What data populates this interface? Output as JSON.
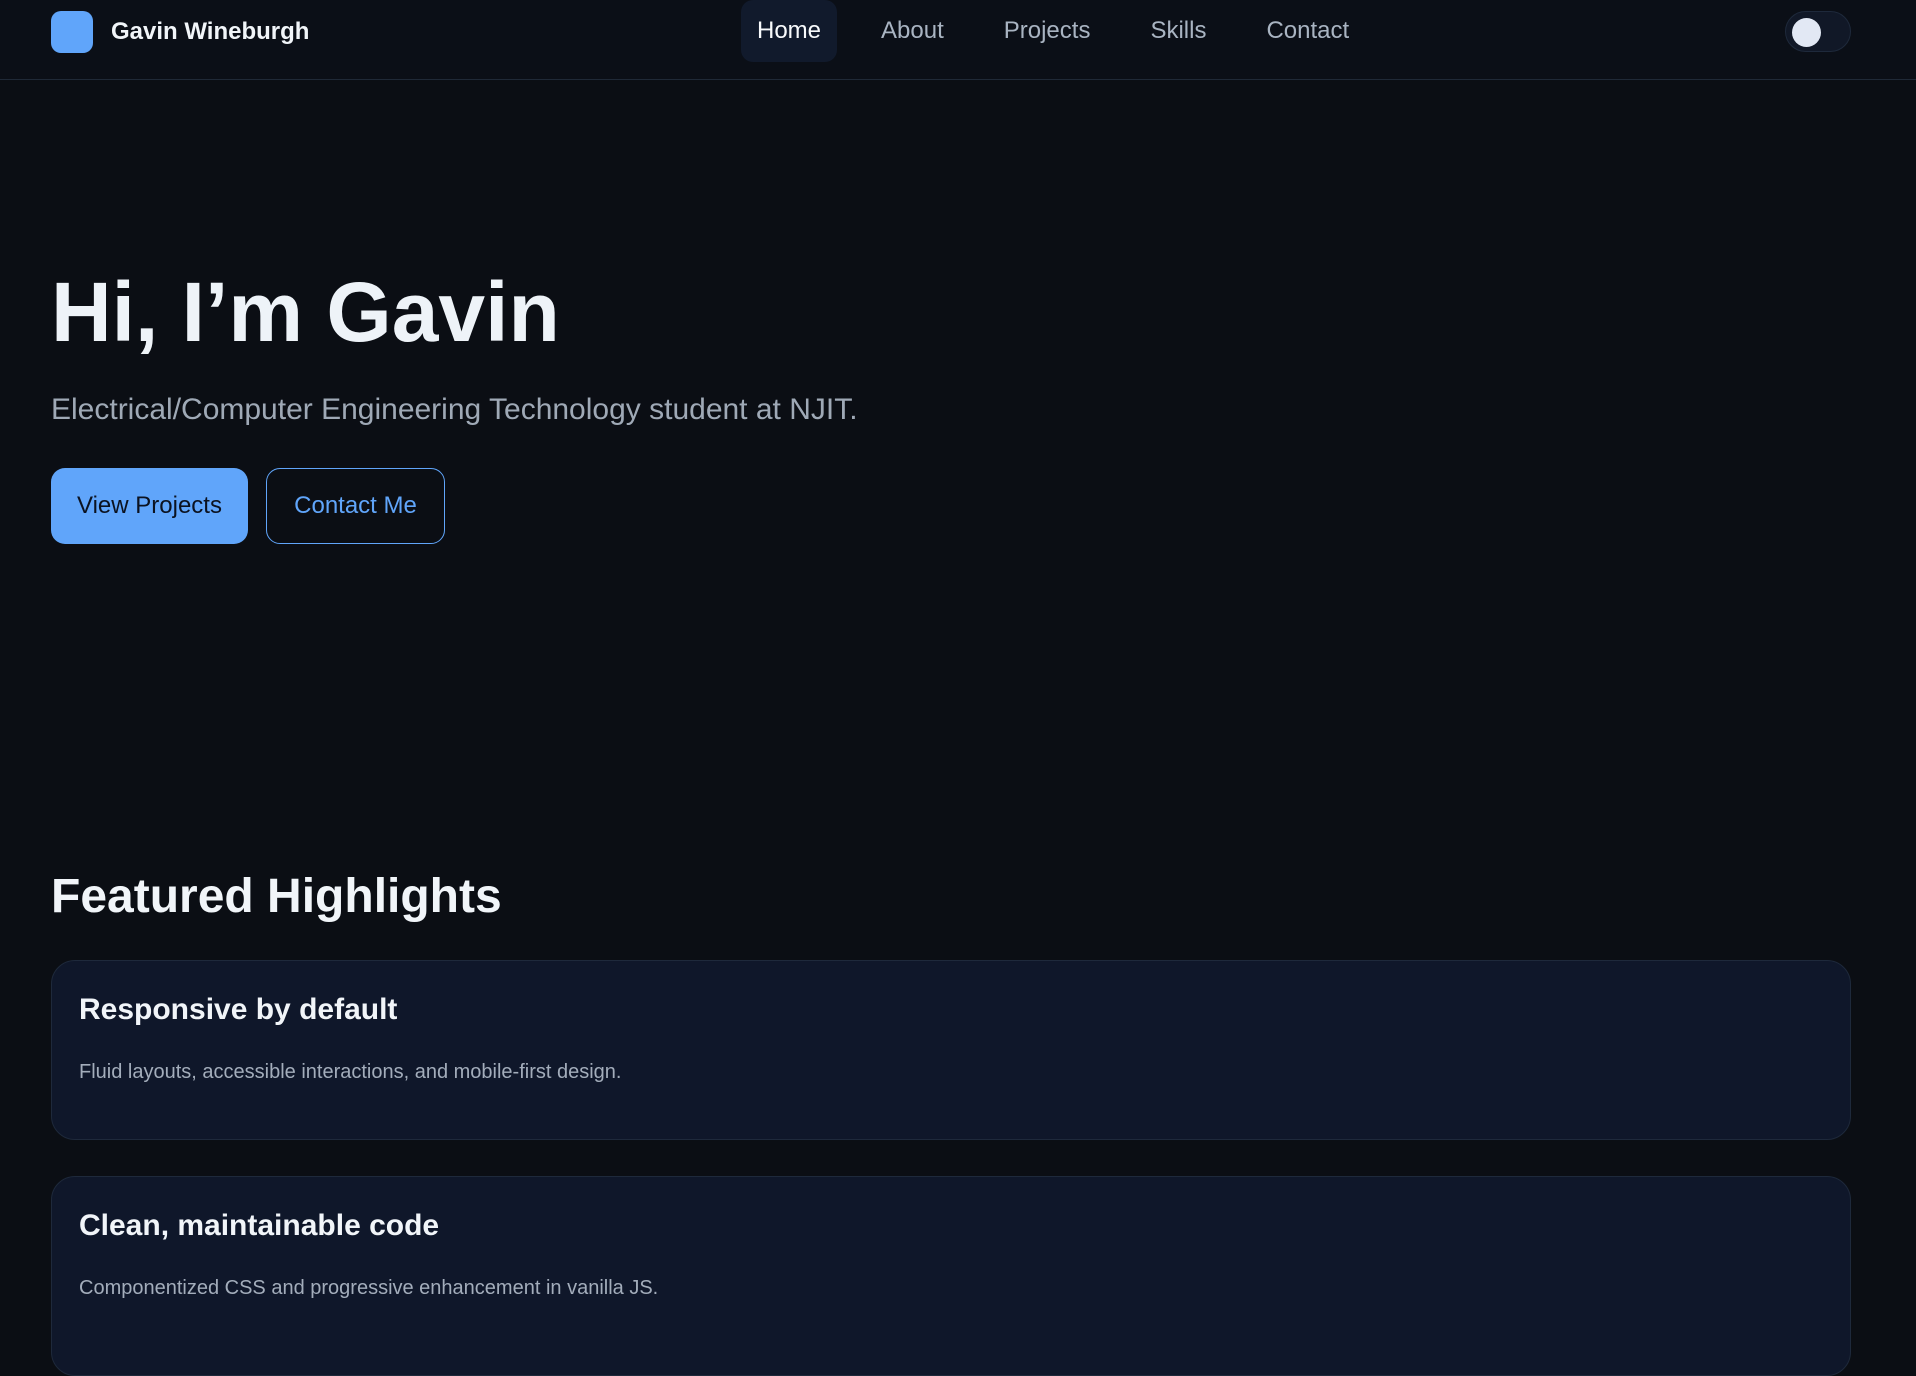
{
  "brand": {
    "name": "Gavin Wineburgh"
  },
  "nav": {
    "items": [
      {
        "label": "Home",
        "active": true
      },
      {
        "label": "About",
        "active": false
      },
      {
        "label": "Projects",
        "active": false
      },
      {
        "label": "Skills",
        "active": false
      },
      {
        "label": "Contact",
        "active": false
      }
    ]
  },
  "hero": {
    "title": "Hi, I’m Gavin",
    "subtitle": "Electrical/Computer Engineering Technology student at NJIT.",
    "primary_button": "View Projects",
    "secondary_button": "Contact Me"
  },
  "highlights": {
    "title": "Featured Highlights",
    "cards": [
      {
        "title": "Responsive by default",
        "description": "Fluid layouts, accessible interactions, and mobile-first design."
      },
      {
        "title": "Clean, maintainable code",
        "description": "Componentized CSS and progressive enhancement in vanilla JS."
      }
    ]
  },
  "colors": {
    "accent": "#60a5fa",
    "background": "#0b0e14",
    "card": "#0f172a"
  }
}
